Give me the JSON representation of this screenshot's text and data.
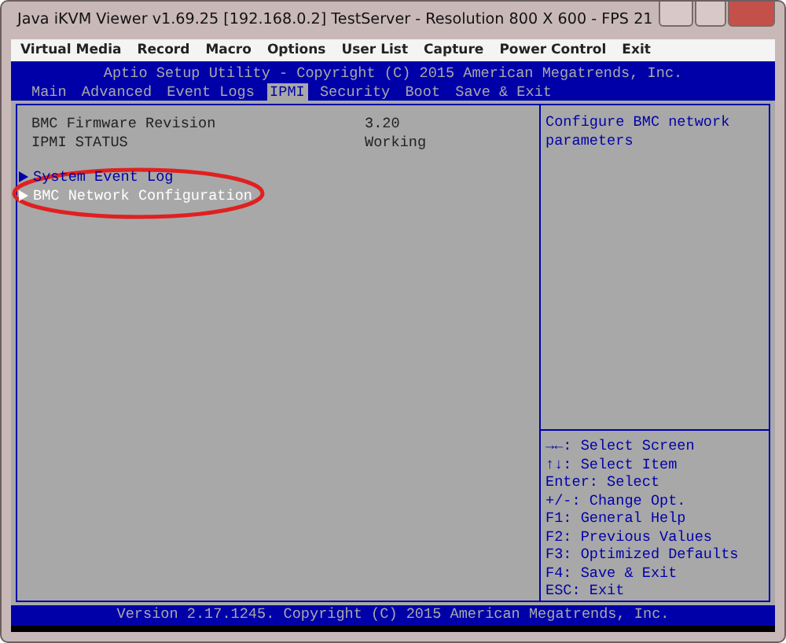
{
  "window": {
    "title": "Java iKVM Viewer v1.69.25 [192.168.0.2] TestServer - Resolution 800 X 600 - FPS 21"
  },
  "menu": [
    "Virtual Media",
    "Record",
    "Macro",
    "Options",
    "User List",
    "Capture",
    "Power Control",
    "Exit"
  ],
  "bios": {
    "header": "Aptio Setup Utility - Copyright (C) 2015 American Megatrends, Inc.",
    "tabs": [
      {
        "label": "Main",
        "selected": false
      },
      {
        "label": "Advanced",
        "selected": false
      },
      {
        "label": "Event Logs",
        "selected": false
      },
      {
        "label": "IPMI",
        "selected": true
      },
      {
        "label": "Security",
        "selected": false
      },
      {
        "label": "Boot",
        "selected": false
      },
      {
        "label": "Save & Exit",
        "selected": false
      }
    ],
    "fields": [
      {
        "label": "BMC Firmware Revision",
        "value": "3.20"
      },
      {
        "label": "IPMI STATUS",
        "value": "Working"
      }
    ],
    "submenus": [
      {
        "label": "System Event Log",
        "selected": false
      },
      {
        "label": "BMC Network Configuration",
        "selected": true
      }
    ],
    "help": "Configure BMC network parameters",
    "keys": [
      "→←: Select Screen",
      "↑↓: Select Item",
      "Enter: Select",
      "+/-: Change Opt.",
      "F1: General Help",
      "F2: Previous Values",
      "F3: Optimized Defaults",
      "F4: Save & Exit",
      "ESC: Exit"
    ],
    "footer": "Version 2.17.1245. Copyright (C) 2015 American Megatrends, Inc."
  }
}
